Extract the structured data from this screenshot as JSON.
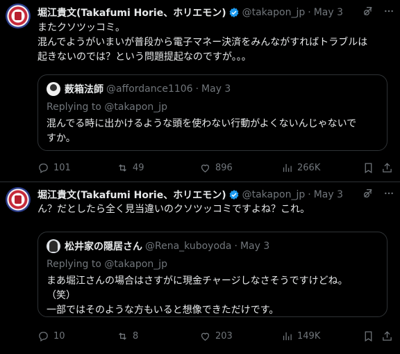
{
  "colors": {
    "background": "#000000",
    "text": "#e7e9ea",
    "secondary": "#71767b",
    "border": "#2f3336",
    "verified": "#1d9bf0"
  },
  "tweets": [
    {
      "author": "堀江貴文(Takafumi Horie、ホリエモン)",
      "handle": "@takapon_jp",
      "date": "May 3",
      "text_lines": [
        "またクソツッコミ。",
        "混んでようがいまいが普段から電子マネー決済をみんながすればトラブルは",
        "起きないのでは？という問題提起なのですが。。。"
      ],
      "quote": {
        "author": "薮箱法師",
        "handle": "@affordance1106",
        "date": "May 3",
        "replying_to": "Replying to @takapon_jp",
        "text_lines": [
          "混んでる時に出かけるような頭を使わない行動がよくないんじゃないで",
          "すか。"
        ]
      },
      "stats": {
        "replies": "101",
        "reposts": "49",
        "likes": "896",
        "views": "266K"
      }
    },
    {
      "author": "堀江貴文(Takafumi Horie、ホリエモン)",
      "handle": "@takapon_jp",
      "date": "May 3",
      "text_lines": [
        "ん？だとしたら全く見当違いのクソツッコミですよね？これ。"
      ],
      "quote": {
        "author": "松井家の隠居さん",
        "handle": "@Rena_kuboyoda",
        "date": "May 3",
        "replying_to": "Replying to @takapon_jp",
        "text_lines": [
          "まあ堀江さんの場合はさすがに現金チャージしなさそうですけどね。",
          "（笑）",
          "一部ではそのような方もいると想像できただけです。"
        ]
      },
      "stats": {
        "replies": "10",
        "reposts": "8",
        "likes": "203",
        "views": "149K"
      }
    }
  ]
}
